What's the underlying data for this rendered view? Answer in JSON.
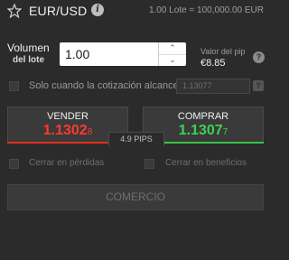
{
  "header": {
    "star_icon": "star-outline-icon",
    "symbol": "EUR/USD",
    "info_glyph": "i",
    "lot_text": "1.00 Lote = 100,000.00 EUR"
  },
  "volume": {
    "label": "Volumen",
    "sublabel": "del lote",
    "value": "1.00",
    "up_glyph": "⌃",
    "down_glyph": "⌄",
    "pip_label": "Valor del pip",
    "pip_value": "€8.85",
    "pip_info_glyph": "?"
  },
  "limit": {
    "label": "Solo cuando la cotización alcance",
    "rate": "1.13077",
    "help_glyph": "?"
  },
  "sell": {
    "label": "VENDER",
    "price_main": "1.1302",
    "price_small": "8",
    "color": "#ff3b2f"
  },
  "buy": {
    "label": "COMPRAR",
    "price_main": "1.1307",
    "price_small": "7",
    "color": "#3fd152"
  },
  "spread": "4.9 PIPS",
  "stop_loss_label": "Cerrar en pérdidas",
  "take_profit_label": "Cerrar en beneficios",
  "trade_button_label": "COMERCIO"
}
